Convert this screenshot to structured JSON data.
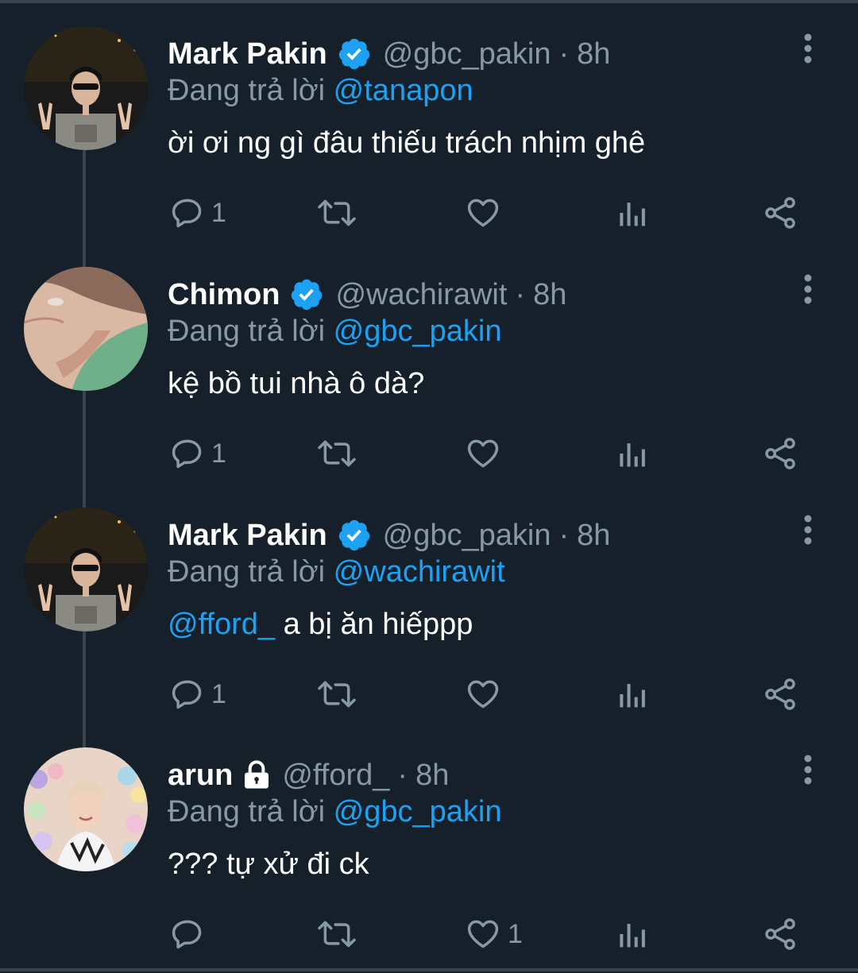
{
  "colors": {
    "background": "#15202b",
    "text_primary": "#ffffff",
    "text_secondary": "#8899a6",
    "accent": "#1da1f2",
    "separator": "#38444d"
  },
  "tweets": [
    {
      "name": "Mark Pakin",
      "verified": true,
      "locked": false,
      "handle": "@gbc_pakin",
      "dot": "·",
      "time": "8h",
      "reply_prefix": "Đang trả lời",
      "reply_to": "@tanapon",
      "body_mention": "",
      "body_text": "ời ơi ng gì đâu thiếu trách nhịm ghê",
      "reply_count": "1",
      "retweet_count": "",
      "like_count": ""
    },
    {
      "name": "Chimon",
      "verified": true,
      "locked": false,
      "handle": "@wachirawit",
      "dot": "·",
      "time": "8h",
      "reply_prefix": "Đang trả lời",
      "reply_to": "@gbc_pakin",
      "body_mention": "",
      "body_text": "kệ bồ tui nhà ô dà?",
      "reply_count": "1",
      "retweet_count": "",
      "like_count": ""
    },
    {
      "name": "Mark Pakin",
      "verified": true,
      "locked": false,
      "handle": "@gbc_pakin",
      "dot": "·",
      "time": "8h",
      "reply_prefix": "Đang trả lời",
      "reply_to": "@wachirawit",
      "body_mention": "@fford_",
      "body_text": " a bị ăn hiếppp",
      "reply_count": "1",
      "retweet_count": "",
      "like_count": ""
    },
    {
      "name": "arun",
      "verified": false,
      "locked": true,
      "handle": "@fford_",
      "dot": "·",
      "time": "8h",
      "reply_prefix": "Đang trả lời",
      "reply_to": "@gbc_pakin",
      "body_mention": "",
      "body_text": "??? tự xử đi ck",
      "reply_count": "",
      "retweet_count": "",
      "like_count": "1"
    }
  ],
  "icons": {
    "verified": "verified-badge-icon",
    "lock": "lock-icon",
    "more": "more-vertical-icon",
    "reply": "reply-icon",
    "retweet": "retweet-icon",
    "like": "heart-icon",
    "analytics": "analytics-icon",
    "share": "share-icon"
  }
}
